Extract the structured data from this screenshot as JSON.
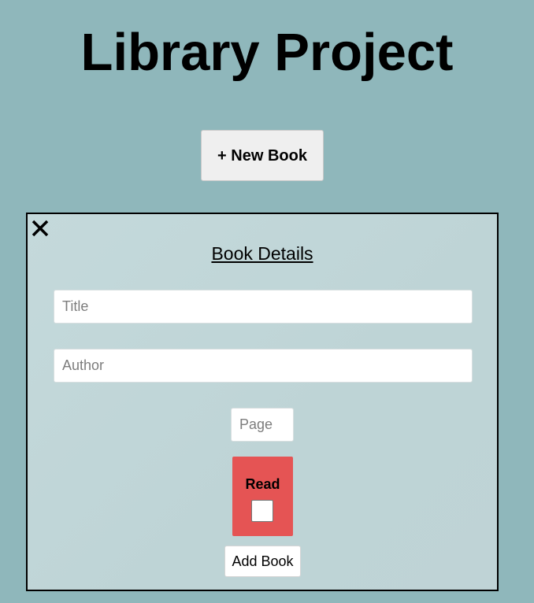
{
  "header": {
    "title": "Library Project"
  },
  "toolbar": {
    "new_book_label": "+ New Book"
  },
  "modal": {
    "close_icon": "close-icon",
    "title": "Book Details",
    "fields": {
      "title": {
        "placeholder": "Title",
        "value": ""
      },
      "author": {
        "placeholder": "Author",
        "value": ""
      },
      "pages": {
        "placeholder": "Page",
        "value": ""
      }
    },
    "read": {
      "label": "Read",
      "checked": false,
      "color": "#e55454"
    },
    "add_button_label": "Add Book"
  },
  "colors": {
    "background": "#8fb7bb",
    "modal_background": "#c4d9db"
  }
}
